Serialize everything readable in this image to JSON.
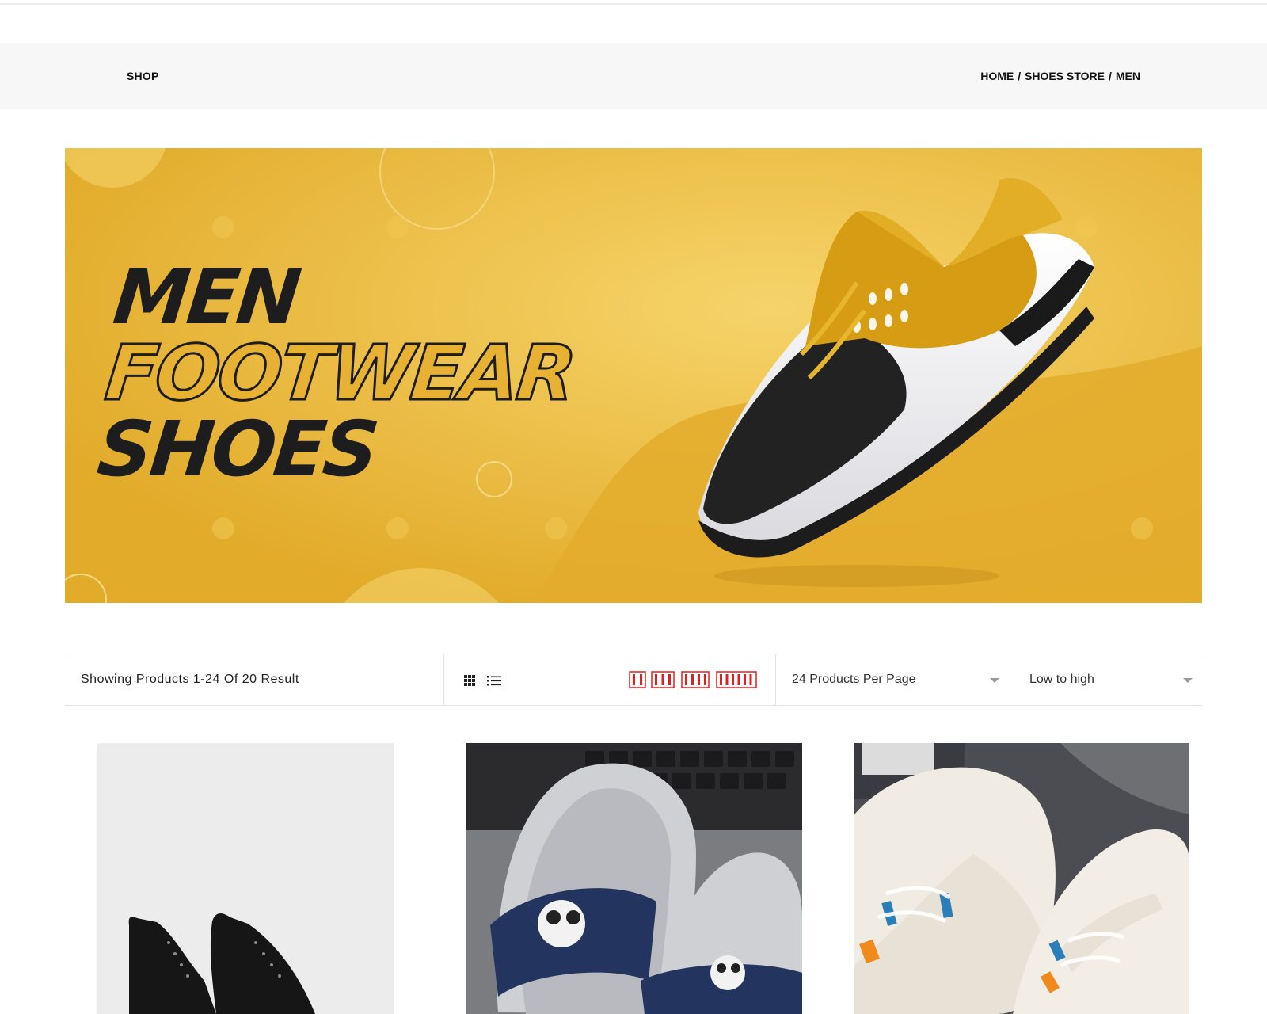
{
  "header": {
    "page_title": "SHOP",
    "breadcrumb": [
      "HOME",
      "SHOES STORE",
      "MEN"
    ],
    "breadcrumb_separator": "/"
  },
  "banner": {
    "line1": "MEN",
    "line2": "FOOTWEAR",
    "line3": "SHOES",
    "background_color": "#e6b232"
  },
  "toolbar": {
    "result_text": "Showing Products 1-24 Of 20 Result",
    "view_modes": [
      "grid-view-icon",
      "list-view-icon"
    ],
    "column_options": [
      2,
      3,
      4,
      6
    ],
    "column_icon_color": "#e02020",
    "per_page": {
      "selected": "24 Products Per Page"
    },
    "sort": {
      "selected": "Low to high"
    }
  },
  "products": [
    {
      "image": "black-leather-boots"
    },
    {
      "image": "grey-dino-slides"
    },
    {
      "image": "white-sneakers"
    }
  ]
}
